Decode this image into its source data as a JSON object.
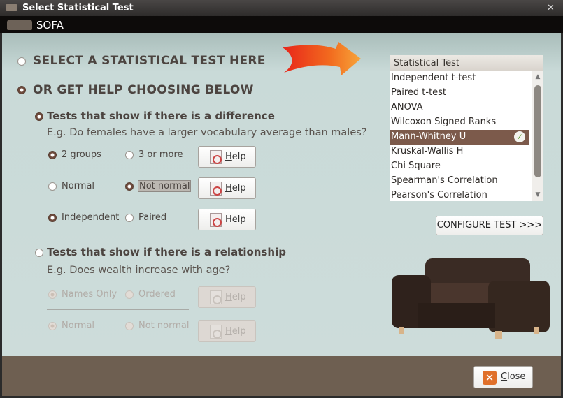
{
  "window": {
    "title": "Select Statistical Test",
    "app_name": "SOFA"
  },
  "options": {
    "select_here": "SELECT A STATISTICAL TEST HERE",
    "help_choose": "OR GET HELP CHOOSING BELOW",
    "difference": {
      "label": "Tests that show if there is a difference",
      "example": "E.g. Do females have a larger vocabulary average than males?",
      "rows": [
        {
          "a": "2 groups",
          "b": "3 or more",
          "selected": "a"
        },
        {
          "a": "Normal",
          "b": "Not normal",
          "selected": "b"
        },
        {
          "a": "Independent",
          "b": "Paired",
          "selected": "a"
        }
      ]
    },
    "relationship": {
      "label": "Tests that show if there is a relationship",
      "example": "E.g. Does wealth increase with age?",
      "rows": [
        {
          "a": "Names Only",
          "b": "Ordered",
          "selected": "a"
        },
        {
          "a": "Normal",
          "b": "Not normal",
          "selected": "a"
        }
      ]
    },
    "help_label": "Help"
  },
  "test_list": {
    "header": "Statistical Test",
    "items": [
      "Independent t-test",
      "Paired t-test",
      "ANOVA",
      "Wilcoxon Signed Ranks",
      "Mann-Whitney U",
      "Kruskal-Wallis H",
      "Chi Square",
      "Spearman's Correlation",
      "Pearson's Correlation"
    ],
    "selected": "Mann-Whitney U"
  },
  "configure_label": "CONFIGURE TEST >>>",
  "close_label": "Close",
  "colors": {
    "accent_brown": "#7c5a4b",
    "footer": "#6e5f51",
    "arrow": "#f05a1a"
  }
}
